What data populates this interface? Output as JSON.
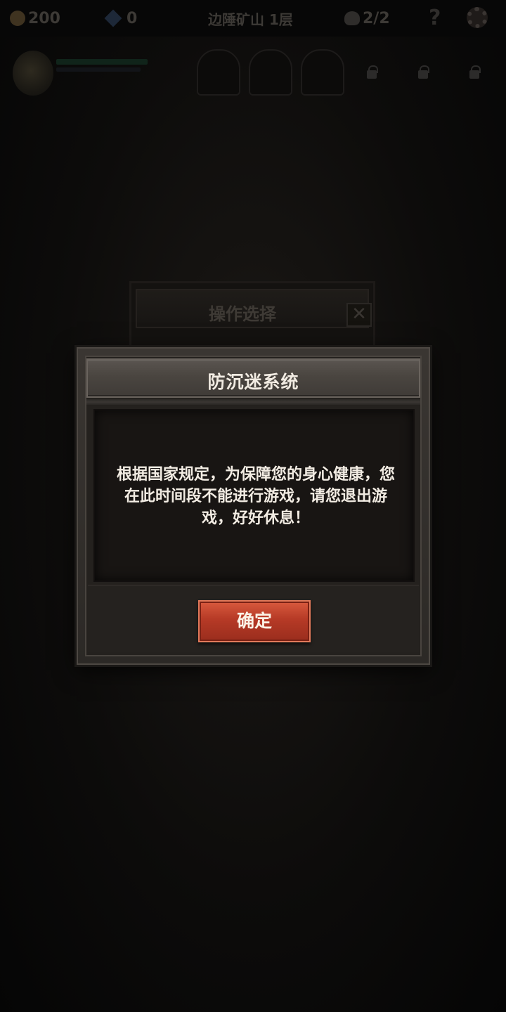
{
  "hud": {
    "coins": "200",
    "gems": "0",
    "location": "边陲矿山 1层",
    "skull_count": "2/2",
    "help": "?",
    "icons": [
      "coin-icon",
      "gem-icon",
      "skull-icon",
      "help-icon",
      "settings-icon"
    ]
  },
  "hero_bar": {
    "slots": [
      "empty",
      "empty",
      "empty",
      "locked",
      "locked",
      "locked"
    ]
  },
  "back_dialog": {
    "title": "操作选择",
    "close": "✕"
  },
  "modal": {
    "title": "防沉迷系统",
    "message": "根据国家规定，为保障您的身心健康，您在此时间段不能进行游戏，请您退出游戏，好好休息！",
    "confirm_label": "确定"
  },
  "colors": {
    "accent_button": "#b63a26",
    "panel": "#2c2926",
    "content_bg": "#181513",
    "text": "#f2ece3"
  }
}
